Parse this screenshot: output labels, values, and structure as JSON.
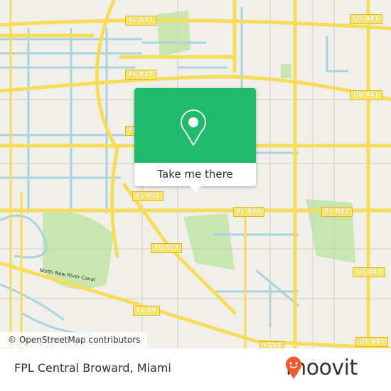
{
  "map": {
    "shields": [
      {
        "label": "FL 817",
        "pos": "a"
      },
      {
        "label": "FL 817",
        "pos": "b"
      },
      {
        "label": "FL 817",
        "pos": "c"
      },
      {
        "label": "FL 817",
        "pos": "d"
      },
      {
        "label": "FL 817",
        "pos": "e"
      },
      {
        "label": "US 441",
        "pos": "f"
      },
      {
        "label": "US 441",
        "pos": "g"
      },
      {
        "label": "US 441",
        "pos": "h"
      },
      {
        "label": "US 441",
        "pos": "i"
      },
      {
        "label": "FL 842",
        "pos": "j"
      },
      {
        "label": "FL 842",
        "pos": "k"
      },
      {
        "label": "FL 84",
        "pos": "l"
      },
      {
        "label": "I 595",
        "pos": "m"
      }
    ],
    "canal_label": "North New River Canal",
    "attribution": "© OpenStreetMap contributors",
    "colors": {
      "water": "#aad3df",
      "road": "#f7dc5a",
      "park": "#c8e6b0",
      "background": "#f1efea"
    }
  },
  "popup": {
    "button_label": "Take me there",
    "color": "#1fba6a",
    "icon": "map-pin-icon"
  },
  "footer": {
    "title": "FPL Central Broward, Miami",
    "logo_text": "moovit",
    "logo_color": "#f15a2b"
  }
}
